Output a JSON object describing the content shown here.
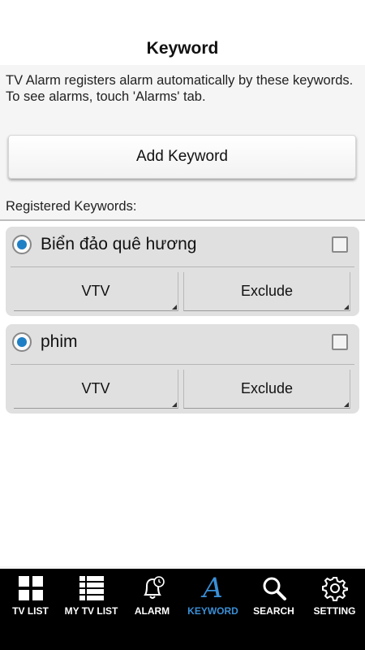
{
  "header": {
    "title": "Keyword"
  },
  "description": {
    "line1": "TV Alarm registers alarm automatically by these keywords.",
    "line2": "To see alarms, touch 'Alarms' tab."
  },
  "add_button_label": "Add Keyword",
  "registered_label": "Registered Keywords:",
  "keywords": [
    {
      "name": "Biển đảo quê hương",
      "channel": "VTV",
      "mode": "Exclude",
      "selected": true,
      "checked": false
    },
    {
      "name": "phim",
      "channel": "VTV",
      "mode": "Exclude",
      "selected": true,
      "checked": false
    }
  ],
  "nav": {
    "items": [
      {
        "label": "TV LIST",
        "icon": "grid-icon"
      },
      {
        "label": "MY TV LIST",
        "icon": "list-icon"
      },
      {
        "label": "ALARM",
        "icon": "bell-icon"
      },
      {
        "label": "KEYWORD",
        "icon": "letter-a-icon"
      },
      {
        "label": "SEARCH",
        "icon": "search-icon"
      },
      {
        "label": "SETTING",
        "icon": "gear-icon"
      }
    ],
    "active_index": 3
  },
  "colors": {
    "accent": "#3a8fd6",
    "radio": "#1e7fc4",
    "nav_bg": "#000000"
  }
}
